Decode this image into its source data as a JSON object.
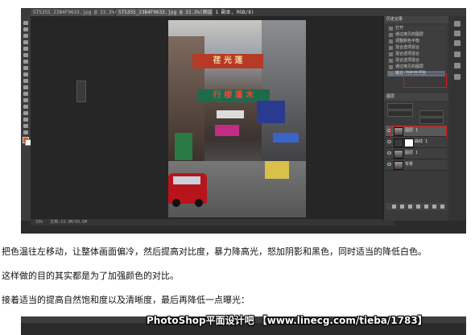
{
  "ps_window": {
    "tabs": [
      "ST5355_23B4F9633.jpg @ 33.3%(图层 1, RGB/8)",
      "ST5355_23B4F9633.jpg @ 33.3%(图层 1 副本, RGB/8)"
    ],
    "status": {
      "zoom": "33%",
      "doc": "文档:23.3M/93.6M"
    },
    "photo_signs": {
      "sign1": "荏 光 莲",
      "sign2": "行 楼 蓬 木"
    },
    "history_panel": {
      "tab": "历史记录",
      "items": [
        "打开",
        "通过拷贝的图层",
        "调整颜色平衡",
        "混合选项混合",
        "混合选项混合",
        "混合选项混合",
        "通过拷贝的图层",
        "曝光/饱和度调整"
      ]
    },
    "layers_panel": {
      "tab": "图层",
      "layers": [
        "图层 1",
        "曲线 1",
        "图层 1",
        "背景"
      ]
    },
    "colors": {
      "accent_red": "#e01818",
      "panel_bg": "#3a3a3a"
    }
  },
  "article": {
    "line1": "把色温往左移动，让整体画面偏冷，然后提高对比度，暴力降高光，怒加阴影和黑色，同时适当的降低白色。",
    "line2": "这样做的目的其实都是为了加强颜色的对比。",
    "line3": "接着适当的提高自然饱和度以及清晰度，最后再降低一点曝光："
  },
  "watermark": "PhotoShop平面设计吧 【www.linecg.com/tieba/1783】"
}
